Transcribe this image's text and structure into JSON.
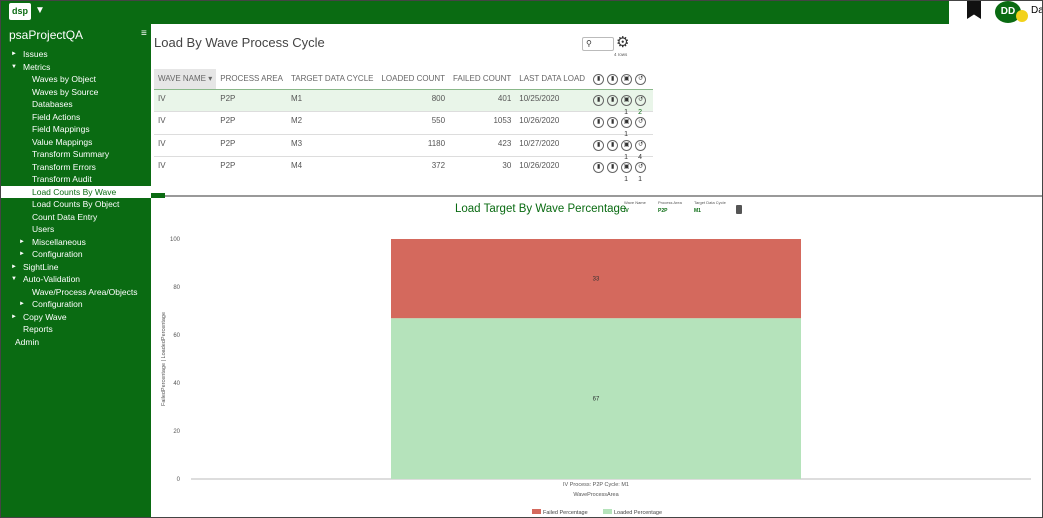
{
  "header": {
    "logo_text": "dsp",
    "caret": "▼",
    "avatar_initials": "DD",
    "user_name_partial": "Da"
  },
  "sidebar": {
    "project": "psaProjectQA",
    "menu_glyph": "≡",
    "items": [
      {
        "label": "Issues",
        "level": 0,
        "toggle": "►"
      },
      {
        "label": "Metrics",
        "level": 0,
        "toggle": "▼"
      },
      {
        "label": "Waves by Object",
        "level": 2
      },
      {
        "label": "Waves by Source",
        "level": 2
      },
      {
        "label": "Databases",
        "level": 2
      },
      {
        "label": "Field Actions",
        "level": 2
      },
      {
        "label": "Field Mappings",
        "level": 2
      },
      {
        "label": "Value Mappings",
        "level": 2
      },
      {
        "label": "Transform Summary",
        "level": 2
      },
      {
        "label": "Transform Errors",
        "level": 2
      },
      {
        "label": "Transform Audit",
        "level": 2
      },
      {
        "label": "Load Counts By Wave",
        "level": 2,
        "active": true
      },
      {
        "label": "Load Counts By Object",
        "level": 2
      },
      {
        "label": "Count Data Entry",
        "level": 2
      },
      {
        "label": "Users",
        "level": 2
      },
      {
        "label": "Miscellaneous",
        "level": 1,
        "toggle": "►"
      },
      {
        "label": "Configuration",
        "level": 1,
        "toggle": "►"
      },
      {
        "label": "SightLine",
        "level": 0,
        "toggle": "►"
      },
      {
        "label": "Auto-Validation",
        "level": 0,
        "toggle": "▼"
      },
      {
        "label": "Wave/Process Area/Objects",
        "level": 2
      },
      {
        "label": "Configuration",
        "level": 1,
        "toggle": "►"
      },
      {
        "label": "Copy Wave",
        "level": 0,
        "toggle": "►"
      },
      {
        "label": "Reports",
        "level": 0
      },
      {
        "label": "Admin",
        "level": -1
      }
    ]
  },
  "page": {
    "title": "Load By Wave Process Cycle",
    "rows_label": "4 rows"
  },
  "grid": {
    "columns": [
      "WAVE NAME ▾",
      "PROCESS AREA",
      "TARGET DATA CYCLE",
      "LOADED COUNT",
      "FAILED COUNT",
      "LAST DATA LOAD"
    ],
    "action_icons": [
      "chart-icon",
      "chart-icon",
      "box-icon",
      "history-icon"
    ],
    "rows": [
      {
        "wave": "IV",
        "area": "P2P",
        "cycle": "M1",
        "loaded": "800",
        "failed": "401",
        "date": "10/25/2020",
        "badges": [
          "",
          "",
          "1",
          "2"
        ],
        "selected": true
      },
      {
        "wave": "IV",
        "area": "P2P",
        "cycle": "M2",
        "loaded": "550",
        "failed": "1053",
        "date": "10/26/2020",
        "badges": [
          "",
          "",
          "1",
          ""
        ]
      },
      {
        "wave": "IV",
        "area": "P2P",
        "cycle": "M3",
        "loaded": "1180",
        "failed": "423",
        "date": "10/27/2020",
        "badges": [
          "",
          "",
          "1",
          "4"
        ]
      },
      {
        "wave": "IV",
        "area": "P2P",
        "cycle": "M4",
        "loaded": "372",
        "failed": "30",
        "date": "10/26/2020",
        "badges": [
          "",
          "",
          "1",
          "1"
        ]
      }
    ]
  },
  "chart_header": {
    "title": "Load Target By Wave Percentage",
    "filters": [
      {
        "label": "Wave Name",
        "value": "IV"
      },
      {
        "label": "Process Area",
        "value": "P2P"
      },
      {
        "label": "Target Data Cycle",
        "value": "M1"
      }
    ]
  },
  "chart_data": {
    "type": "bar",
    "stacked": true,
    "categories": [
      "IV Process: P2P Cycle: M1"
    ],
    "series": [
      {
        "name": "Loaded Percentage",
        "values": [
          67
        ],
        "color": "#b5e3bb"
      },
      {
        "name": "Failed Percentage",
        "values": [
          33
        ],
        "color": "#d4695d"
      }
    ],
    "xlabel": "WaveProcessArea",
    "ylabel": "FailedPercentage | LoadedPercentage",
    "ylim": [
      0,
      100
    ],
    "yticks": [
      0,
      20,
      40,
      60,
      80,
      100
    ],
    "data_labels": [
      "67",
      "33"
    ],
    "legend_position": "bottom"
  }
}
